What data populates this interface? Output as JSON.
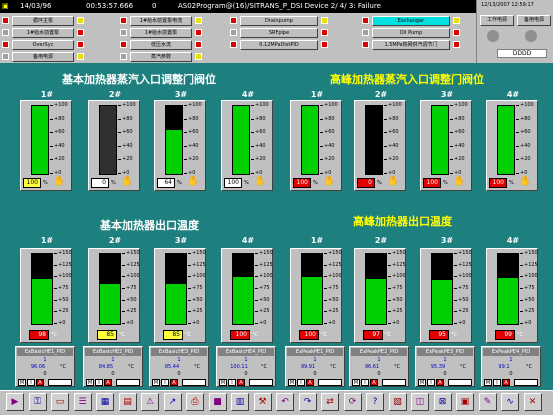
{
  "titlebar": {
    "date": "14/03/96",
    "time": "00:53:57.666",
    "count": "0",
    "message": "AS02Program@(16)/SITRANS_P_DSI Device 2/ 4/ 3: Failure",
    "datetime": "12/13/2007 12:59:17"
  },
  "toolbar": {
    "col1": [
      "循环主泵",
      "1#给水前置泵",
      "OverSyc",
      "备用电源"
    ],
    "col2": [
      "1#给水前置泵电流",
      "1#给水前置泵",
      "低压水流",
      "蒸汽参数"
    ],
    "col3": [
      "Drainpump",
      "SRFpipe",
      "0.12MPaDistPID"
    ],
    "col4": [
      "Exchanger",
      "Oil Pump",
      "1.5MPa热网供汽调节门"
    ]
  },
  "right_panel": {
    "btn1": "工作电源",
    "btn2": "备用电源",
    "code": "DDDD"
  },
  "sections": {
    "s1": "基本加热器蒸汽入口调整门阀位",
    "s2": "高峰加热器蒸汽入口调整门阀位",
    "s3": "基本加热器出口温度",
    "s4": "高峰加热器出口温度"
  },
  "valve_gauges": [
    {
      "label": "1#",
      "value": "100",
      "unit": "%",
      "level": 1.0,
      "dark": false,
      "hl": "yel"
    },
    {
      "label": "2#",
      "value": "0",
      "unit": "%",
      "level": 0.0,
      "dark": true,
      "hl": "white"
    },
    {
      "label": "3#",
      "value": "64",
      "unit": "%",
      "level": 0.64,
      "dark": false,
      "hl": "white"
    },
    {
      "label": "4#",
      "value": "100",
      "unit": "%",
      "level": 1.0,
      "dark": false,
      "hl": "white"
    },
    {
      "label": "1#",
      "value": "100",
      "unit": "%",
      "level": 1.0,
      "dark": false,
      "hl": "red"
    },
    {
      "label": "2#",
      "value": "0",
      "unit": "%",
      "level": 0.0,
      "dark": false,
      "hl": "red"
    },
    {
      "label": "3#",
      "value": "100",
      "unit": "%",
      "level": 1.0,
      "dark": false,
      "hl": "red"
    },
    {
      "label": "4#",
      "value": "100",
      "unit": "%",
      "level": 1.0,
      "dark": false,
      "hl": "red"
    }
  ],
  "valve_ticks": [
    "+100",
    "+80",
    "+60",
    "+40",
    "+20",
    "+0"
  ],
  "temp_gauges": [
    {
      "label": "1#",
      "value": "98",
      "unit": "°C",
      "level": 0.65,
      "hl": "red"
    },
    {
      "label": "2#",
      "value": "85",
      "unit": "°C",
      "level": 0.57,
      "hl": "yel"
    },
    {
      "label": "3#",
      "value": "85",
      "unit": "°C",
      "level": 0.57,
      "hl": "yel"
    },
    {
      "label": "4#",
      "value": "100",
      "unit": "°C",
      "level": 0.67,
      "hl": "red"
    },
    {
      "label": "1#",
      "value": "100",
      "unit": "°C",
      "level": 0.67,
      "hl": "red"
    },
    {
      "label": "2#",
      "value": "97",
      "unit": "°C",
      "level": 0.65,
      "hl": "red"
    },
    {
      "label": "3#",
      "value": "95",
      "unit": "°C",
      "level": 0.63,
      "hl": "red"
    },
    {
      "label": "4#",
      "value": "99",
      "unit": "°C",
      "level": 0.66,
      "hl": "red"
    }
  ],
  "temp_ticks": [
    "+150",
    "+125",
    "+100",
    "+75",
    "+50",
    "+25",
    "+0"
  ],
  "pid_cards": [
    {
      "name": "ExBasicHE1_PID",
      "sp": "1",
      "pv": "96.06",
      "out": "0",
      "unit": "°C"
    },
    {
      "name": "ExBasicHE2_PID",
      "sp": "1",
      "pv": "84.85",
      "out": "0",
      "unit": "°C"
    },
    {
      "name": "ExBasicHE3_PID",
      "sp": "1",
      "pv": "85.44",
      "out": "0",
      "unit": "°C"
    },
    {
      "name": "ExBasicHE4_PID",
      "sp": "1",
      "pv": "100.11",
      "out": "0",
      "unit": "°C"
    },
    {
      "name": "ExPeakPE1_PID",
      "sp": "1",
      "pv": "99.91",
      "out": "0",
      "unit": "°C"
    },
    {
      "name": "ExPeakPE2_PID",
      "sp": "1",
      "pv": "96.61",
      "out": "0",
      "unit": "°C"
    },
    {
      "name": "ExPeakPE3_PID",
      "sp": "1",
      "pv": "95.39",
      "out": "0",
      "unit": "°C"
    },
    {
      "name": "ExPeakPE4_PID",
      "sp": "1",
      "pv": "99.1",
      "out": "0",
      "unit": "°C"
    }
  ],
  "pid_buttons": [
    "M",
    "I",
    "A"
  ],
  "bottom_icons": [
    "play-icon",
    "key-icon",
    "window-icon",
    "list-icon",
    "grid-icon",
    "document-icon",
    "alarm-icon",
    "trend-icon",
    "print-icon",
    "stop-icon",
    "report-icon",
    "tools-icon",
    "back-icon",
    "forward-icon",
    "swap-icon",
    "refresh-icon",
    "help-icon",
    "chart-icon",
    "dialog-icon",
    "exit-icon",
    "bitmap-icon",
    "pen-icon",
    "graph-icon",
    "close-icon"
  ]
}
